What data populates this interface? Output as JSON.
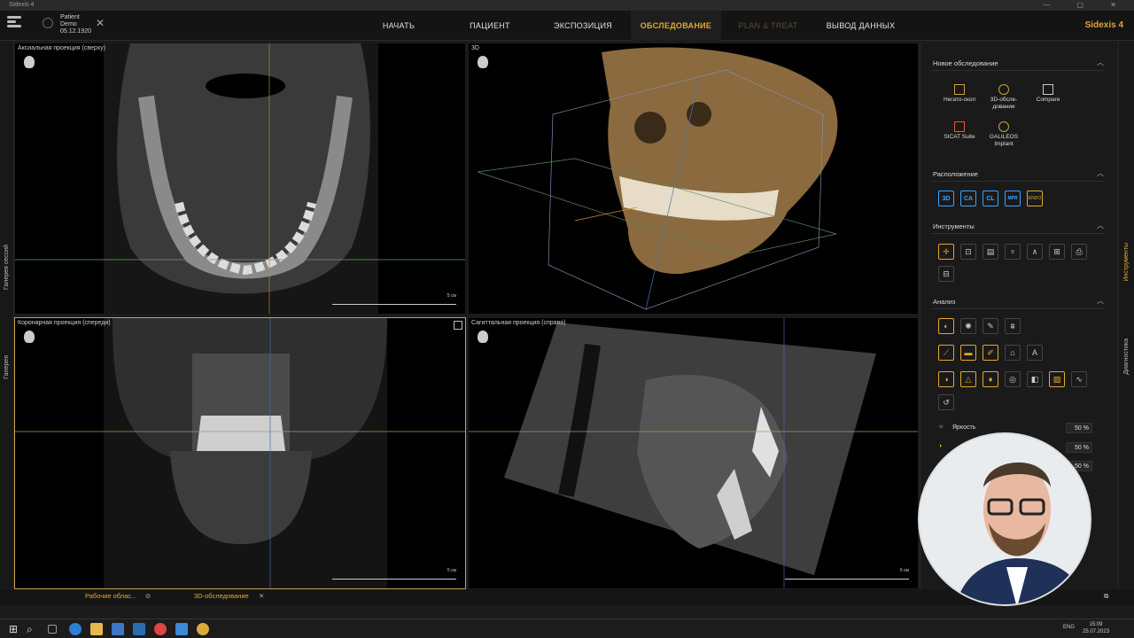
{
  "window": {
    "title": "Sidexis 4",
    "controls": "— ▢ ✕"
  },
  "header": {
    "patient_name": "Patient",
    "patient_surname": "Demo",
    "patient_dob": "05.12.1920",
    "nav": [
      "НАЧАТЬ",
      "ПАЦИЕНТ",
      "ЭКСПОЗИЦИЯ",
      "ОБСЛЕДОВАНИЕ",
      "PLAN & TREAT",
      "ВЫВОД ДАННЫХ"
    ],
    "active_nav": "ОБСЛЕДОВАНИЕ",
    "brand": "Sidexis 4"
  },
  "left_strip": {
    "sessions": "Галерея сессий",
    "gallery": "Галерея"
  },
  "viewports": {
    "axial": {
      "label": "Аксиальная проекция (сверху)",
      "scale": "5 см"
    },
    "threed": {
      "label": "3D"
    },
    "coronal": {
      "label": "Коронарная проекция (спереди)",
      "scale": "5 см"
    },
    "sagittal": {
      "label": "Сагиттальная проекция (справа)",
      "scale": "5 см"
    }
  },
  "panel": {
    "new_exam": "Новое обследование",
    "apps": [
      {
        "label": "Негато-скоп"
      },
      {
        "label": "3D-обсле-дование"
      },
      {
        "label": "Compare"
      },
      {
        "label": "SICAT Suite"
      },
      {
        "label": "GALILEOS Implant"
      }
    ],
    "layout": "Расположение",
    "layout_buttons": [
      "3D",
      "CA",
      "CL",
      "MPR",
      "ENDO"
    ],
    "tools": "Инструменты",
    "analysis": "Анализ",
    "brightness": {
      "label": "Яркость",
      "value": "50",
      "unit": "%"
    },
    "contrast": {
      "value": "50",
      "unit": "%"
    },
    "third": {
      "value": "50",
      "unit": "%"
    }
  },
  "right_strip": {
    "tools": "Инструменты",
    "diagnostics": "Диагностика"
  },
  "bottom_tabs": {
    "workspaces": "Рабочие облас...",
    "exam": "3D-обследование"
  },
  "taskbar": {
    "lang": "ENG",
    "time": "15:09",
    "date": "25.07.2023"
  }
}
